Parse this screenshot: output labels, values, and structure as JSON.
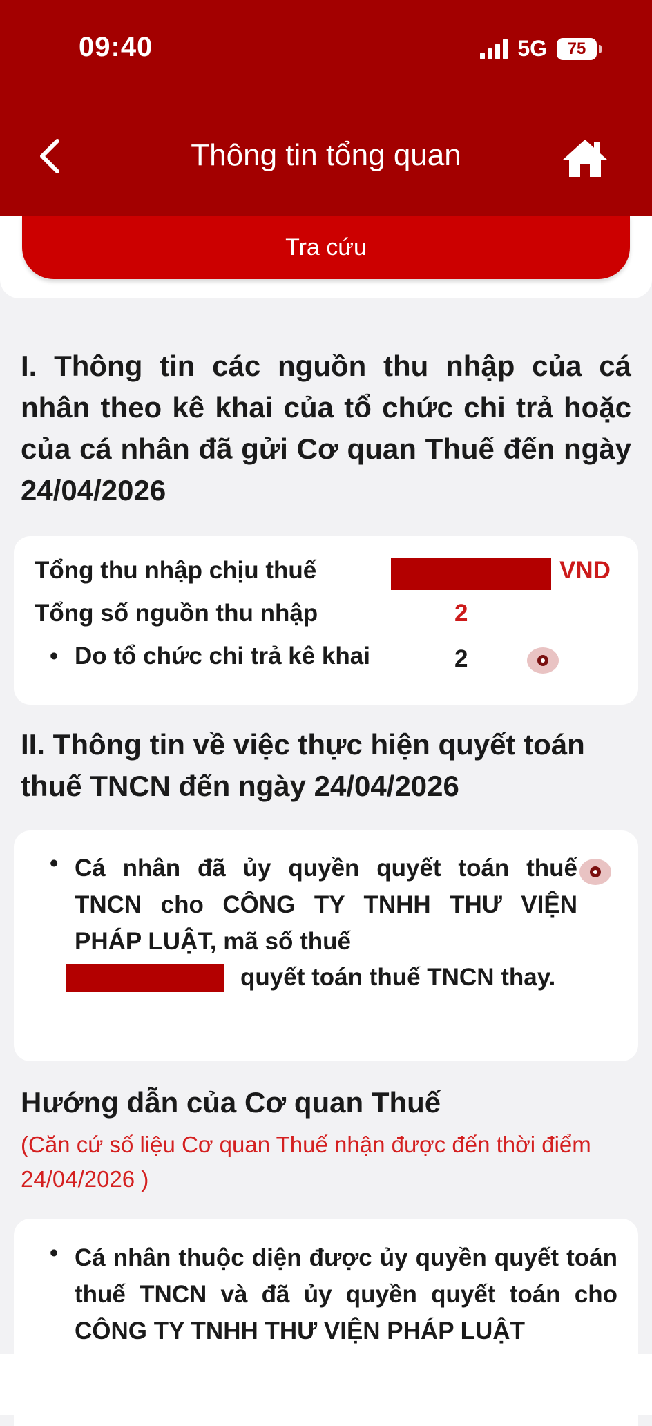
{
  "status": {
    "time": "09:40",
    "network": "5G",
    "battery": "75"
  },
  "header": {
    "title": "Thông tin tổng quan"
  },
  "search_button": "Tra cứu",
  "section1": {
    "heading": "I. Thông tin các nguồn thu nhập của cá nhân theo kê khai của tổ chức chi trả hoặc của cá nhân đã gửi Cơ quan Thuế đến ngày 24/04/2026",
    "total_income_label": "Tổng thu nhập chịu thuế",
    "currency": "VND",
    "income_sources_label": "Tổng số nguồn thu nhập",
    "income_sources_value": "2",
    "declared_by_org_label": "Do tổ chức chi trả kê khai",
    "declared_by_org_value": "2"
  },
  "section2": {
    "heading": "II. Thông tin về việc thực hiện quyết toán thuế TNCN đến ngày 24/04/2026",
    "text_line1": "Cá nhân đã ủy quyền quyết toán thuế TNCN cho CÔNG TY TNHH THƯ VIỆN PHÁP LUẬT, mã số thuế",
    "text_line2": "quyết toán thuế TNCN thay."
  },
  "guidance": {
    "heading": "Hướng dẫn của Cơ quan Thuế",
    "note": "(Căn cứ số liệu Cơ quan Thuế nhận được đến thời điểm 24/04/2026 )",
    "text": "Cá nhân thuộc diện được ủy quyền quyết toán thuế TNCN và đã ủy quyền quyết toán cho CÔNG TY TNHH THƯ VIỆN PHÁP LUẬT"
  },
  "colors": {
    "header": "#a30000",
    "accent": "#cc0000",
    "mask": "#b30000"
  }
}
